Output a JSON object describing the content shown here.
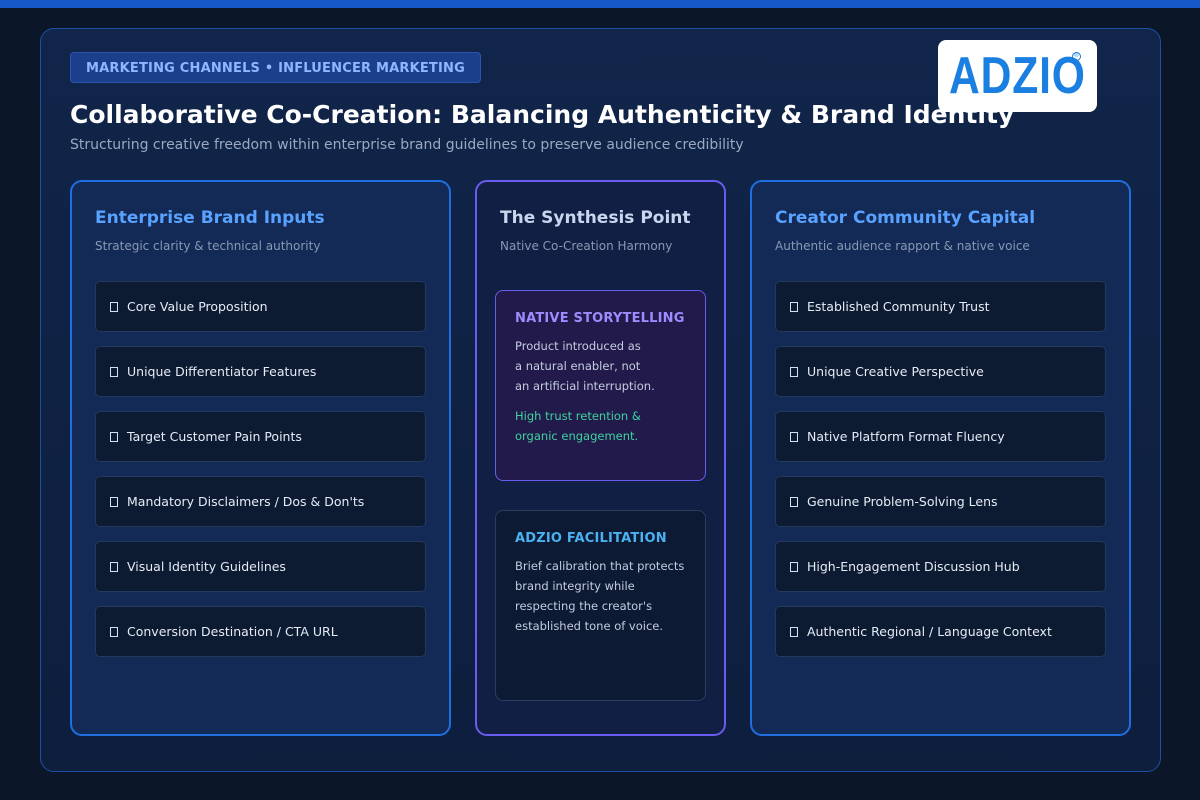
{
  "header": {
    "category_tag": "MARKETING CHANNELS • INFLUENCER MARKETING",
    "title": "Collaborative Co-Creation: Balancing Authenticity & Brand Identity",
    "subtitle": "Structuring creative freedom within enterprise brand guidelines to preserve audience credibility",
    "logo_text": "ADZIO",
    "logo_mark": "®"
  },
  "colors": {
    "accent_blue": "#1f6fe0",
    "accent_violet": "#6a5cf0",
    "highlight_green": "#3fd2a0"
  },
  "columns": {
    "left": {
      "title": "Enterprise Brand Inputs",
      "subtitle": "Strategic clarity & technical authority",
      "items": [
        {
          "label": "Core Value Proposition",
          "icon": "document-icon"
        },
        {
          "label": "Unique Differentiator Features",
          "icon": "document-icon"
        },
        {
          "label": "Target Customer Pain Points",
          "icon": "document-icon"
        },
        {
          "label": "Mandatory Disclaimers / Dos & Don'ts",
          "icon": "document-icon"
        },
        {
          "label": "Visual Identity Guidelines",
          "icon": "document-icon"
        },
        {
          "label": "Conversion Destination / CTA URL",
          "icon": "document-icon"
        }
      ]
    },
    "middle": {
      "title": "The Synthesis Point",
      "subtitle": "Native Co-Creation Harmony",
      "cards": [
        {
          "title": "NATIVE STORYTELLING",
          "lines": [
            "Product introduced as",
            "a natural enabler, not",
            "an artificial interruption."
          ],
          "highlight": [
            "High trust retention &",
            "organic engagement."
          ]
        },
        {
          "title": "ADZIO FACILITATION",
          "lines": [
            "Brief calibration that protects",
            "brand integrity while",
            "respecting the creator's",
            "established tone of voice."
          ]
        }
      ]
    },
    "right": {
      "title": "Creator Community Capital",
      "subtitle": "Authentic audience rapport & native voice",
      "items": [
        {
          "label": "Established Community Trust",
          "icon": "document-icon"
        },
        {
          "label": "Unique Creative Perspective",
          "icon": "document-icon"
        },
        {
          "label": "Native Platform Format Fluency",
          "icon": "document-icon"
        },
        {
          "label": "Genuine Problem-Solving Lens",
          "icon": "document-icon"
        },
        {
          "label": "High-Engagement Discussion Hub",
          "icon": "document-icon"
        },
        {
          "label": "Authentic Regional / Language Context",
          "icon": "document-icon"
        }
      ]
    }
  }
}
